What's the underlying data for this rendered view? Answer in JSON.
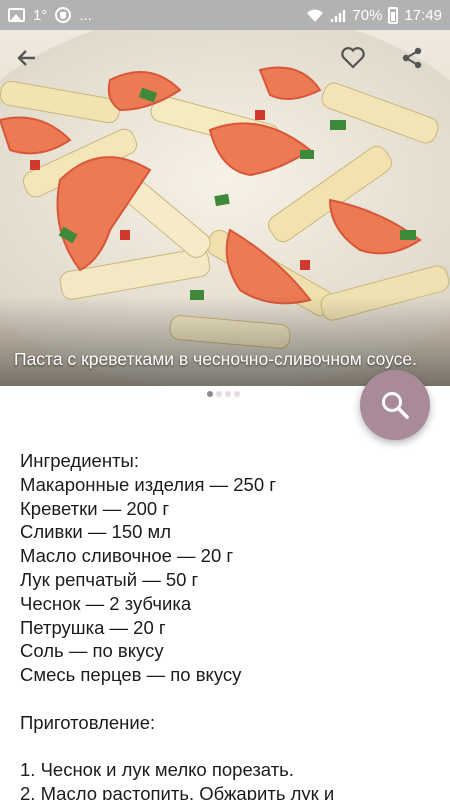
{
  "status_bar": {
    "left_icons": [
      "image-icon",
      "shield-icon"
    ],
    "temperature": "1°",
    "more": "...",
    "battery": "70%",
    "time": "17:49"
  },
  "hero": {
    "caption": "Паста с креветками в чесночно-сливочном соусе.",
    "buttons": [
      "back-arrow-icon",
      "heart-icon",
      "share-icon"
    ]
  },
  "pager": {
    "count": 4,
    "active": 0
  },
  "fab": {
    "icon": "search-icon",
    "color": "#a88a99"
  },
  "recipe": {
    "ingredients_title": "Ингредиенты:",
    "ingredients": [
      "Макаронные изделия — 250 г",
      "Креветки — 200 г",
      "Сливки — 150 мл",
      "Масло сливочное — 20 г",
      "Лук репчатый — 50 г",
      "Чеснок — 2 зубчика",
      "Петрушка — 20 г",
      "Соль — по вкусу",
      "Смесь перцев — по вкусу"
    ],
    "steps_title": "Приготовление:",
    "steps": [
      "1. Чеснок и лук мелко порезать.",
      "2. Масло растопить. Обжарить лук и"
    ]
  }
}
